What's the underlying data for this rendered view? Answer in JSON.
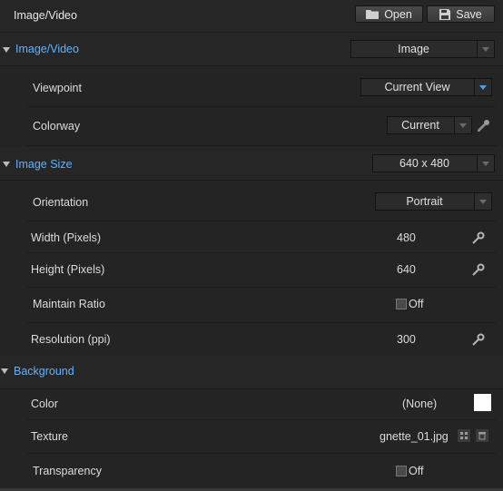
{
  "header": {
    "title": "Image/Video",
    "open_label": "Open",
    "save_label": "Save"
  },
  "sections": {
    "image_video": {
      "label": "Image/Video",
      "mode_value": "Image",
      "viewpoint": {
        "label": "Viewpoint",
        "value": "Current View"
      },
      "colorway": {
        "label": "Colorway",
        "value": "Current"
      }
    },
    "image_size": {
      "label": "Image Size",
      "size_value": "640 x 480",
      "orientation": {
        "label": "Orientation",
        "value": "Portrait"
      },
      "width": {
        "label": "Width (Pixels)",
        "value": "480"
      },
      "height": {
        "label": "Height (Pixels)",
        "value": "640"
      },
      "maintain_ratio": {
        "label": "Maintain Ratio",
        "value": "Off"
      },
      "resolution": {
        "label": "Resolution (ppi)",
        "value": "300"
      }
    },
    "background": {
      "label": "Background",
      "color": {
        "label": "Color",
        "value": "(None)",
        "swatch": "#ffffff"
      },
      "texture": {
        "label": "Texture",
        "value": "gnette_01.jpg"
      },
      "transparency": {
        "label": "Transparency",
        "value": "Off"
      }
    }
  },
  "colors": {
    "accent": "#5fb3ff",
    "panel": "#242424"
  }
}
